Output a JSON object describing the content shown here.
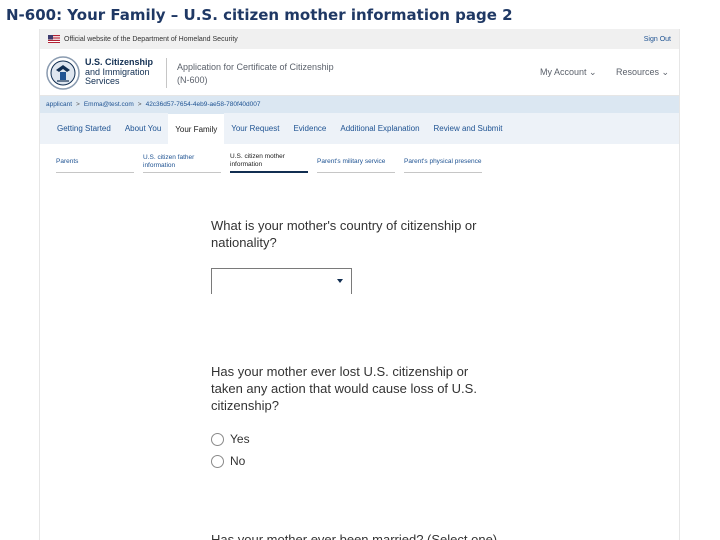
{
  "slide_title": "N-600: Your Family – U.S. citizen mother information page 2",
  "gov_banner": {
    "official_text": "Official website of the Department of Homeland Security",
    "sign_out": "Sign Out"
  },
  "header": {
    "agency_line1": "U.S. Citizenship",
    "agency_line2": "and Immigration",
    "agency_line3": "Services",
    "app_title_line1": "Application for Certificate of Citizenship",
    "app_title_line2": "(N-600)",
    "my_account": "My Account ⌄",
    "resources": "Resources ⌄"
  },
  "breadcrumb": {
    "items": [
      "applicant",
      "Emma@test.com",
      "42c36d57-7654-4eb9-ae58-780f40d007"
    ],
    "separator": ">"
  },
  "tabs": [
    {
      "label": "Getting Started",
      "active": false
    },
    {
      "label": "About You",
      "active": false
    },
    {
      "label": "Your Family",
      "active": true
    },
    {
      "label": "Your Request",
      "active": false
    },
    {
      "label": "Evidence",
      "active": false
    },
    {
      "label": "Additional Explanation",
      "active": false
    },
    {
      "label": "Review and Submit",
      "active": false
    }
  ],
  "subtabs": [
    {
      "label": "Parents",
      "active": false
    },
    {
      "label": "U.S. citizen father information",
      "active": false
    },
    {
      "label": "U.S. citizen mother information",
      "active": true
    },
    {
      "label": "Parent's military service",
      "active": false
    },
    {
      "label": "Parent's physical presence",
      "active": false
    }
  ],
  "questions": {
    "citizenship_country": "What is your mother's country of citizenship or nationality?",
    "citizenship_select_value": "",
    "lost_citizenship": "Has your mother ever lost U.S. citizenship or taken any action that would cause loss of U.S. citizenship?",
    "options": [
      "Yes",
      "No"
    ],
    "next_question_partial": "Has your mother ever been married? (Select one)"
  },
  "colors": {
    "title_blue": "#1f3864",
    "link_blue": "#205493",
    "dark_navy": "#112e51",
    "breadcrumb_bg": "#dbe7f2",
    "tabs_bg": "#edf2f8"
  }
}
